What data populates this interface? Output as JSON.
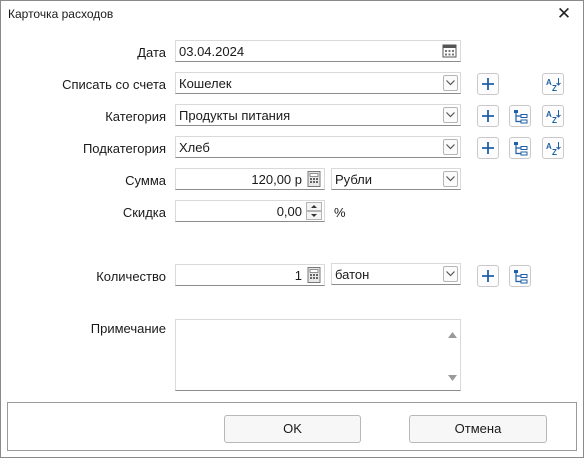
{
  "window": {
    "title": "Карточка расходов",
    "close_glyph": "✕"
  },
  "form": {
    "date": {
      "label": "Дата",
      "value": "03.04.2024"
    },
    "account": {
      "label": "Списать со счета",
      "value": "Кошелек"
    },
    "category": {
      "label": "Категория",
      "value": "Продукты питания"
    },
    "subcategory": {
      "label": "Подкатегория",
      "value": "Хлеб"
    },
    "amount": {
      "label": "Сумма",
      "value": "120,00 р",
      "currency": "Рубли"
    },
    "discount": {
      "label": "Скидка",
      "value": "0,00",
      "unit": "%"
    },
    "quantity": {
      "label": "Количество",
      "value": "1",
      "unit": "батон"
    },
    "note": {
      "label": "Примечание",
      "value": ""
    }
  },
  "buttons": {
    "ok": "OK",
    "cancel": "Отмена"
  },
  "icons": {
    "add": "plus-icon",
    "tree": "category-tree-icon",
    "sort": "sort-az-icon",
    "calendar": "calendar-icon",
    "calculator": "calculator-icon"
  },
  "colors": {
    "accent": "#1f5fa8",
    "border": "#d9d9d9"
  }
}
